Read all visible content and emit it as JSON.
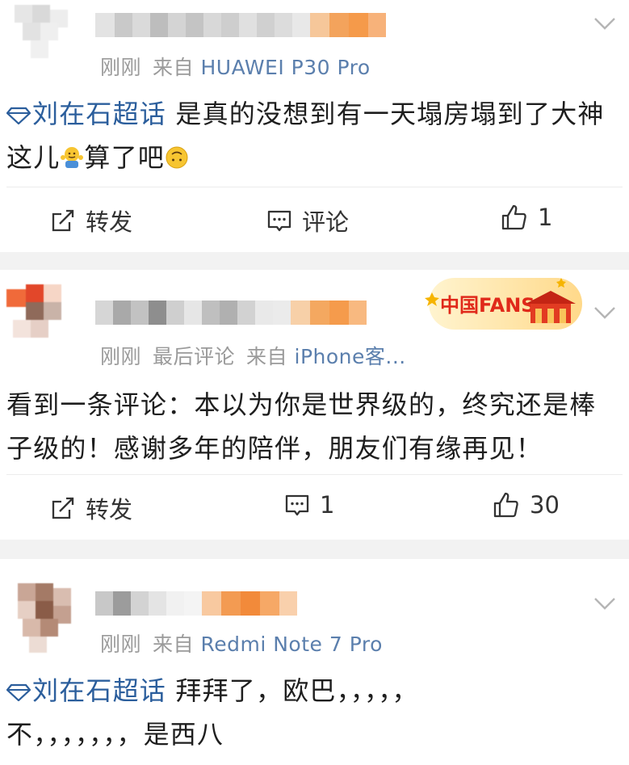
{
  "posts": [
    {
      "time": "刚刚",
      "extra": "",
      "source_prefix": "来自",
      "source": "HUAWEI P30 Pro",
      "topic": "刘在石超话",
      "text_line1": "是真的没想到有一天塌房塌到了大神",
      "text_line2_a": "这儿",
      "text_line2_b": "算了吧",
      "repost_label": "转发",
      "comment_label": "评论",
      "like_count": "1"
    },
    {
      "time": "刚刚",
      "extra": "最后评论",
      "source_prefix": "来自",
      "source": "iPhone客...",
      "badge_text": "中国FANS",
      "text_line1": "看到一条评论：本以为你是世界级的，终究还是棒",
      "text_line2": "子级的！感谢多年的陪伴，朋友们有缘再见！",
      "repost_label": "转发",
      "comment_count": "1",
      "like_count": "30"
    },
    {
      "time": "刚刚",
      "extra": "",
      "source_prefix": "来自",
      "source": "Redmi Note 7 Pro",
      "topic": "刘在石超话",
      "text_line1": "拜拜了，欧巴，，，，，",
      "text_line2": "不，，，，，，，是西八"
    }
  ],
  "colors": {
    "topic": "#2b5e9c",
    "source": "#5b7fad",
    "meta": "#9a9a9a",
    "separator": "#f2f2f2"
  },
  "icons": [
    "chevron-down-icon",
    "repost-icon",
    "comment-icon",
    "like-icon",
    "topic-diamond-icon"
  ]
}
